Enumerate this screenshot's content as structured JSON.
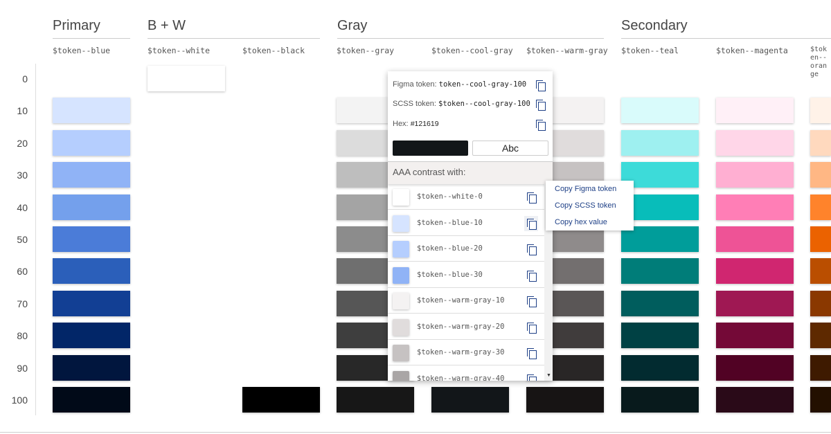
{
  "sections": [
    {
      "label": "Primary"
    },
    {
      "label": "B + W"
    },
    {
      "label": "Gray"
    },
    {
      "label": "Secondary"
    }
  ],
  "rows": [
    "0",
    "10",
    "20",
    "30",
    "40",
    "50",
    "60",
    "70",
    "80",
    "90",
    "100"
  ],
  "columns": [
    {
      "token": "$token--blue",
      "colors": [
        null,
        "#d6e4ff",
        "#b5cefe",
        "#90b3f6",
        "#74a0ec",
        "#4b7cd8",
        "#2b5fba",
        "#123f94",
        "#022668",
        "#01163e",
        "#010a18"
      ]
    },
    {
      "token": "$token--white",
      "colors": [
        "#ffffff",
        null,
        null,
        null,
        null,
        null,
        null,
        null,
        null,
        null,
        null
      ]
    },
    {
      "token": "$token--black",
      "colors": [
        null,
        null,
        null,
        null,
        null,
        null,
        null,
        null,
        null,
        null,
        "#000000"
      ]
    },
    {
      "token": "$token--gray",
      "colors": [
        null,
        "#f3f3f3",
        "#dcdcdc",
        "#bebebe",
        "#a4a4a4",
        "#8c8c8c",
        "#6f6f6f",
        "#565656",
        "#3e3e3e",
        "#282828",
        "#171717"
      ]
    },
    {
      "token": "$token--cool-gray",
      "colors": [
        null,
        null,
        null,
        null,
        null,
        null,
        null,
        null,
        null,
        null,
        "#121619"
      ]
    },
    {
      "token": "$token--warm-gray",
      "colors": [
        null,
        "#f4f2f2",
        "#e0dcdc",
        "#c6c2c2",
        "#aaa6a6",
        "#8f8b8b",
        "#736f6f",
        "#5a5656",
        "#403c3c",
        "#292626",
        "#171414"
      ]
    },
    {
      "token": "$token--teal",
      "colors": [
        null,
        "#d9fbfb",
        "#9ef0f0",
        "#3ddbd9",
        "#08bdba",
        "#009d9a",
        "#007d79",
        "#005d5d",
        "#004144",
        "#022b30",
        "#081a1c"
      ]
    },
    {
      "token": "$token--magenta",
      "colors": [
        null,
        "#fff0f7",
        "#ffd6e8",
        "#ffafd2",
        "#ff7eb6",
        "#ee5396",
        "#d02670",
        "#9f1853",
        "#740937",
        "#510224",
        "#2a0a18"
      ]
    },
    {
      "token": "$token--orange",
      "colors": [
        null,
        "#fff2e8",
        "#ffd9be",
        "#ffb784",
        "#ff832b",
        "#eb6200",
        "#ba4e00",
        "#8a3800",
        "#5e2900",
        "#3e1a00",
        "#231000"
      ]
    }
  ],
  "popup": {
    "figma_label": "Figma token:",
    "figma_value": "token--cool-gray-100",
    "scss_label": "SCSS token:",
    "scss_value": "$token--cool-gray-100",
    "hex_label": "Hex:",
    "hex_value": "#121619",
    "sample_text": "Abc",
    "contrast_title": "AAA contrast with:",
    "contrast": [
      {
        "name": "$token--white-0",
        "color": "#ffffff"
      },
      {
        "name": "$token--blue-10",
        "color": "#d6e4ff"
      },
      {
        "name": "$token--blue-20",
        "color": "#b5cefe"
      },
      {
        "name": "$token--blue-30",
        "color": "#90b3f6"
      },
      {
        "name": "$token--warm-gray-10",
        "color": "#f4f2f2"
      },
      {
        "name": "$token--warm-gray-20",
        "color": "#e0dcdc"
      },
      {
        "name": "$token--warm-gray-30",
        "color": "#c6c2c2"
      },
      {
        "name": "$token--warm-gray-40",
        "color": "#aaa6a6"
      }
    ]
  },
  "menu": {
    "copy_figma": "Copy Figma token",
    "copy_scss": "Copy SCSS token",
    "copy_hex": "Copy hex value"
  }
}
